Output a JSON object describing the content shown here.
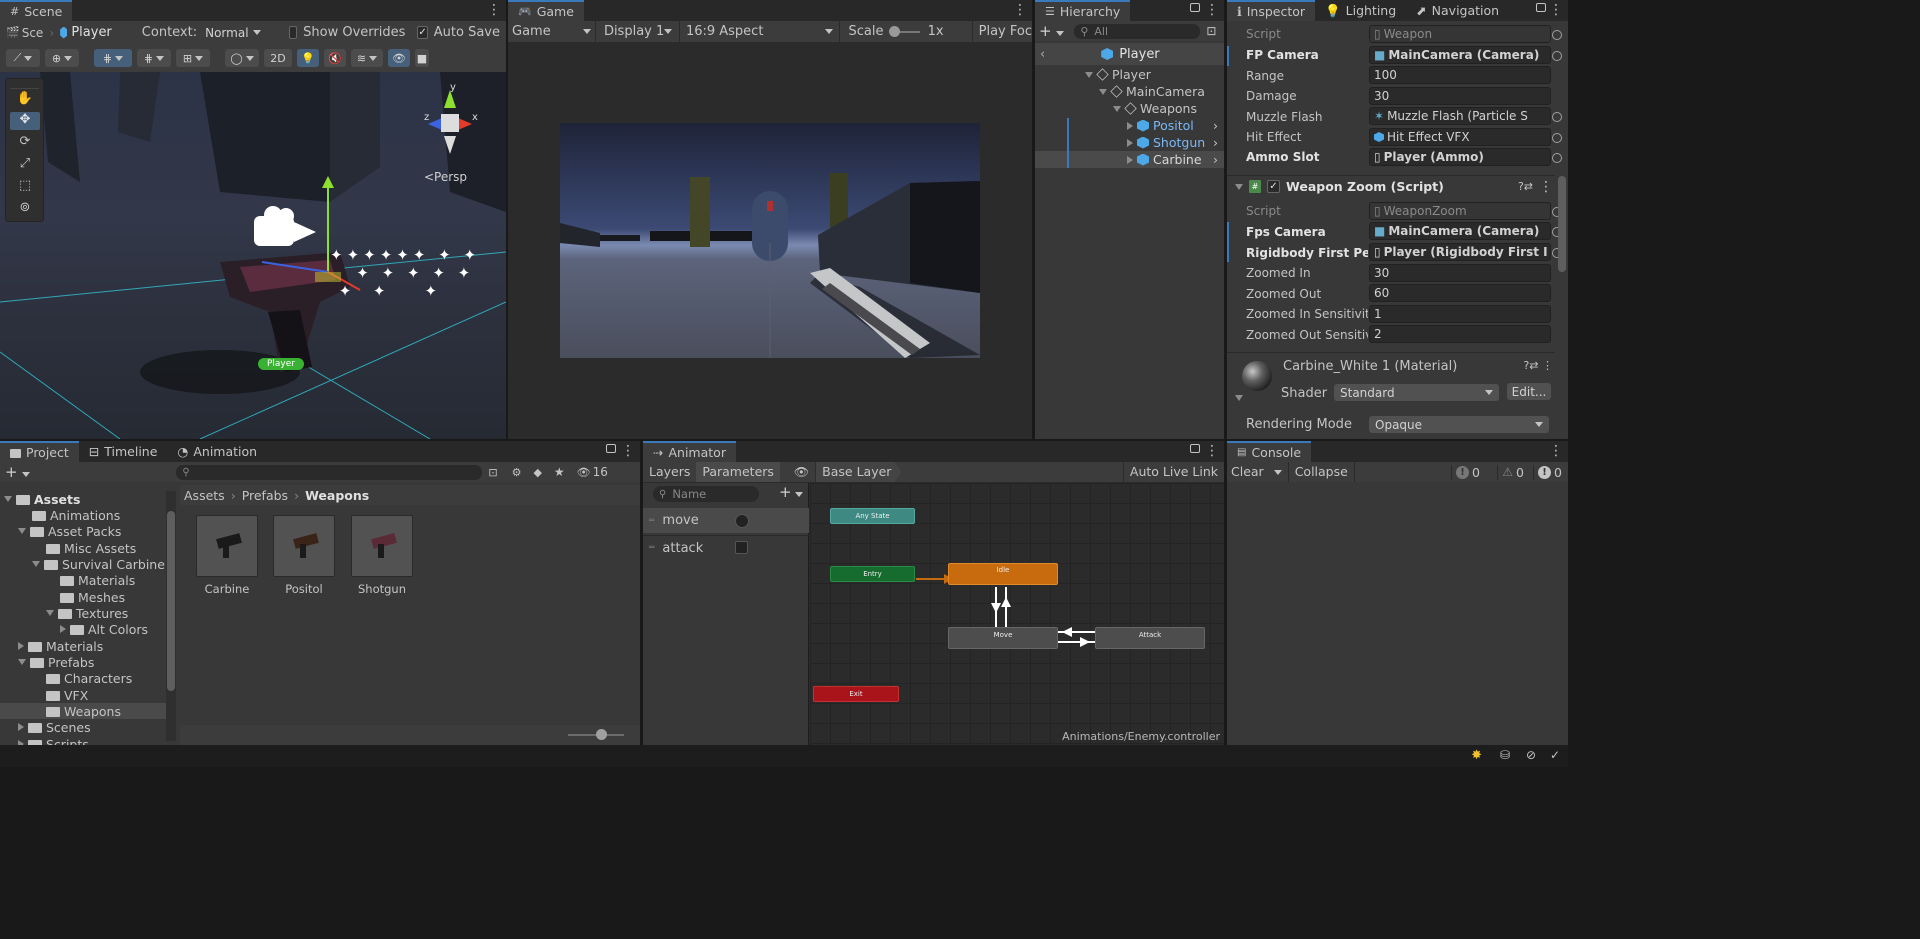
{
  "scene": {
    "tab_label": "Scene",
    "breadcrumb_short": "Sce",
    "breadcrumb_object": "Player",
    "context_label": "Context:",
    "context_value": "Normal",
    "show_overrides": "Show Overrides",
    "show_overrides_checked": false,
    "auto_save": "Auto Save",
    "auto_save_checked": true,
    "btn_2d": "2D",
    "persp_label": "<Persp",
    "gizmo_axes": {
      "y": "y",
      "x": "x",
      "z": "z"
    },
    "player_tag": "Player"
  },
  "game": {
    "tab_label": "Game",
    "mode": "Game",
    "display": "Display 1",
    "aspect": "16:9 Aspect",
    "scale_label": "Scale",
    "scale_value": "1x",
    "play_focused": "Play Foc"
  },
  "hierarchy": {
    "tab_label": "Hierarchy",
    "search_placeholder": "All",
    "header": "Player",
    "items": [
      {
        "label": "Player"
      },
      {
        "label": "MainCamera"
      },
      {
        "label": "Weapons"
      },
      {
        "label": "Positol"
      },
      {
        "label": "Shotgun"
      },
      {
        "label": "Carbine"
      }
    ]
  },
  "inspector": {
    "tabs": [
      "Inspector",
      "Lighting",
      "Navigation"
    ],
    "weapon_fields": [
      {
        "label": "Script",
        "value": "Weapon"
      },
      {
        "label": "FP Camera",
        "value": "MainCamera (Camera)"
      },
      {
        "label": "Range",
        "value": "100"
      },
      {
        "label": "Damage",
        "value": "30"
      },
      {
        "label": "Muzzle Flash",
        "value": "Muzzle Flash (Particle S"
      },
      {
        "label": "Hit Effect",
        "value": "Hit Effect VFX"
      },
      {
        "label": "Ammo Slot",
        "value": "Player (Ammo)"
      }
    ],
    "zoom_component_title": "Weapon Zoom (Script)",
    "zoom_fields": [
      {
        "label": "Script",
        "value": "WeaponZoom"
      },
      {
        "label": "Fps Camera",
        "value": "MainCamera (Camera)"
      },
      {
        "label": "Rigidbody First Pers",
        "value": "Player (Rigidbody First I"
      },
      {
        "label": "Zoomed In",
        "value": "30"
      },
      {
        "label": "Zoomed Out",
        "value": "60"
      },
      {
        "label": "Zoomed In Sensitivit",
        "value": "1"
      },
      {
        "label": "Zoomed Out Sensitiv",
        "value": "2"
      }
    ],
    "material_title": "Carbine_White 1 (Material)",
    "shader_label": "Shader",
    "shader_value": "Standard",
    "edit_button": "Edit...",
    "rendering_mode_label": "Rendering Mode",
    "rendering_mode_value": "Opaque"
  },
  "project": {
    "tabs": [
      "Project",
      "Timeline",
      "Animation"
    ],
    "hidden_count": "16",
    "breadcrumb": [
      "Assets",
      "Prefabs",
      "Weapons"
    ],
    "tree": [
      {
        "label": "Assets"
      },
      {
        "label": "Animations"
      },
      {
        "label": "Asset Packs"
      },
      {
        "label": "Misc Assets"
      },
      {
        "label": "Survival Carbine"
      },
      {
        "label": "Materials"
      },
      {
        "label": "Meshes"
      },
      {
        "label": "Textures"
      },
      {
        "label": "Alt Colors"
      },
      {
        "label": "Materials"
      },
      {
        "label": "Prefabs"
      },
      {
        "label": "Characters"
      },
      {
        "label": "VFX"
      },
      {
        "label": "Weapons"
      },
      {
        "label": "Scenes"
      },
      {
        "label": "Scripts"
      }
    ],
    "assets": [
      {
        "label": "Carbine"
      },
      {
        "label": "Positol"
      },
      {
        "label": "Shotgun"
      }
    ]
  },
  "animator": {
    "tab_label": "Animator",
    "layers_tab": "Layers",
    "parameters_tab": "Parameters",
    "base_layer": "Base Layer",
    "auto_live_link": "Auto Live Link",
    "name_placeholder": "Name",
    "parameters": [
      {
        "label": "move",
        "type": "trigger"
      },
      {
        "label": "attack",
        "type": "bool"
      }
    ],
    "states": {
      "any_state": "Any State",
      "entry": "Entry",
      "idle": "Idle",
      "move": "Move",
      "attack": "Attack",
      "exit": "Exit"
    },
    "controller_path": "Animations/Enemy.controller"
  },
  "console": {
    "tab_label": "Console",
    "clear": "Clear",
    "collapse": "Collapse",
    "error_count": "0",
    "warning_count": "0",
    "info_count": "0"
  },
  "colors": {
    "accent_blue": "#3a79bb",
    "node_orange": "#c86b0e",
    "node_green": "#166b2e",
    "node_teal": "#3e8a83",
    "node_red": "#a8141a",
    "node_gray": "#4d4d4d"
  }
}
